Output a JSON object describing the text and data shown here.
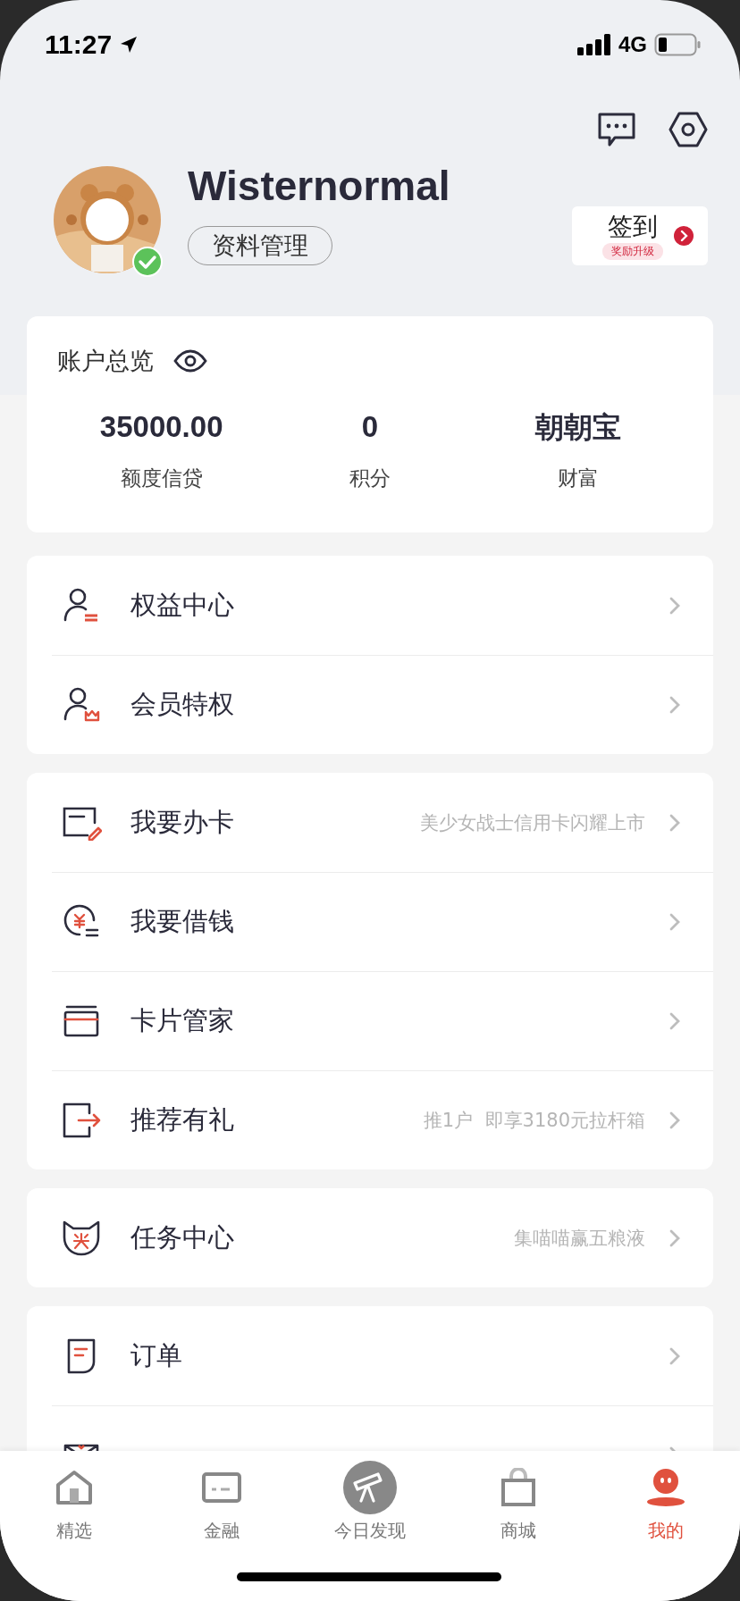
{
  "status_bar": {
    "time": "11:27",
    "network": "4G"
  },
  "profile": {
    "name": "Wisternormal",
    "verified": true,
    "edit_button": "资料管理",
    "checkin": {
      "label": "签到",
      "badge": "奖励升级"
    }
  },
  "account_overview": {
    "title": "账户总览",
    "stats": [
      {
        "value": "35000.00",
        "label": "额度信贷",
        "kind": "number"
      },
      {
        "value": "0",
        "label": "积分",
        "kind": "number"
      },
      {
        "value": "朝朝宝",
        "label": "财富",
        "kind": "text"
      }
    ]
  },
  "menu_groups": [
    [
      {
        "label": "权益中心"
      },
      {
        "label": "会员特权"
      }
    ],
    [
      {
        "label": "我要办卡",
        "note": "美少女战士信用卡闪耀上市"
      },
      {
        "label": "我要借钱"
      },
      {
        "label": "卡片管家"
      },
      {
        "label": "推荐有礼",
        "note": "推1户  即享3180元拉杆箱"
      }
    ],
    [
      {
        "label": "任务中心",
        "note": "集喵喵赢五粮液"
      }
    ],
    [
      {
        "label": "订单"
      },
      {
        "cut_off": true
      }
    ]
  ],
  "tab_bar": [
    {
      "label": "精选",
      "selected": false
    },
    {
      "label": "金融",
      "selected": false
    },
    {
      "label": "今日发现",
      "selected": false
    },
    {
      "label": "商城",
      "selected": false
    },
    {
      "label": "我的",
      "selected": true
    }
  ]
}
